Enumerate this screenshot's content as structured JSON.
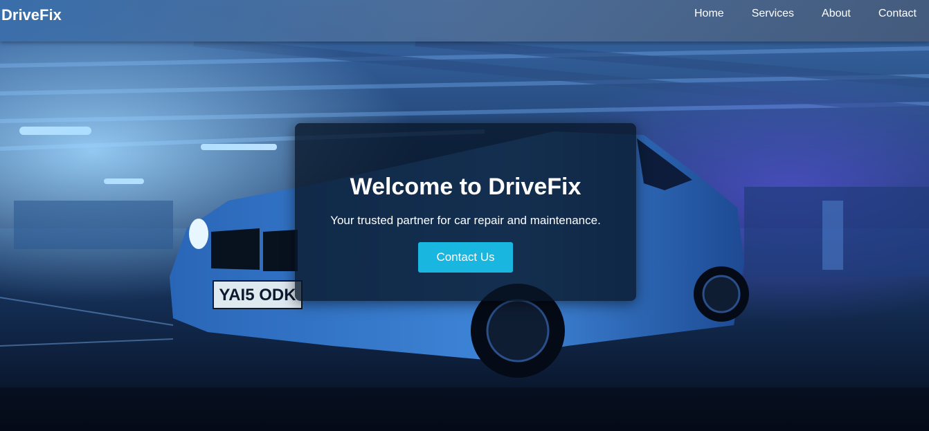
{
  "navbar": {
    "brand": "DriveFix",
    "links": [
      {
        "label": "Home"
      },
      {
        "label": "Services"
      },
      {
        "label": "About"
      },
      {
        "label": "Contact"
      }
    ]
  },
  "hero": {
    "title": "Welcome to DriveFix",
    "subtitle": "Your trusted partner for car repair and maintenance.",
    "cta_label": "Contact Us",
    "license_plate": "YAI5 ODK",
    "background_image": "blue sports car in parking garage",
    "colors": {
      "accent": "#19b6e0",
      "navbar": "#4a6f9e",
      "card": "#081628"
    }
  }
}
